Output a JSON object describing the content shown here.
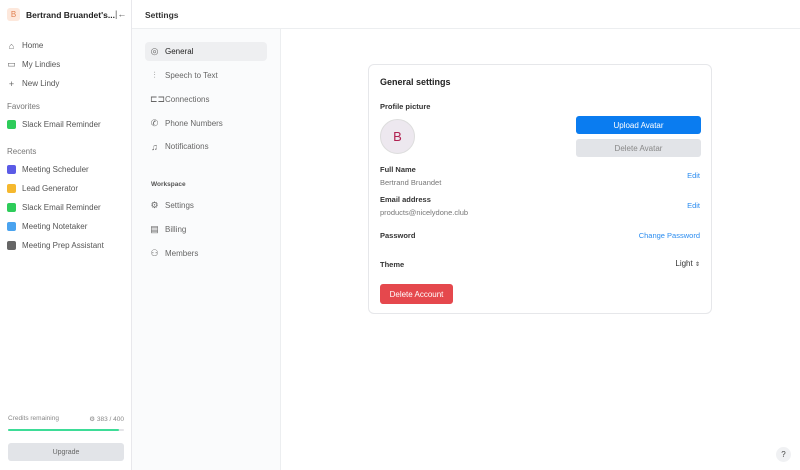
{
  "workspace": {
    "initial": "B",
    "name": "Bertrand Bruandet's..."
  },
  "sidebar": {
    "nav": [
      {
        "label": "Home",
        "icon": "home-icon"
      },
      {
        "label": "My Lindies",
        "icon": "folder-icon"
      },
      {
        "label": "New Lindy",
        "icon": "plus-icon"
      }
    ],
    "favorites_label": "Favorites",
    "favorites": [
      {
        "label": "Slack Email Reminder",
        "color": "#2ecc5a"
      }
    ],
    "recents_label": "Recents",
    "recents": [
      {
        "label": "Meeting Scheduler",
        "color": "#5b5be6"
      },
      {
        "label": "Lead Generator",
        "color": "#f5b82e"
      },
      {
        "label": "Slack Email Reminder",
        "color": "#2ecc5a"
      },
      {
        "label": "Meeting Notetaker",
        "color": "#4aa3ef"
      },
      {
        "label": "Meeting Prep Assistant",
        "color": "#666666"
      }
    ],
    "credits_label": "Credits remaining",
    "credits_value": "383 / 400",
    "credits_fraction": 0.9575,
    "upgrade": "Upgrade"
  },
  "header": {
    "title": "Settings"
  },
  "settings_nav": {
    "items": [
      {
        "label": "General",
        "icon": "user-circle-icon",
        "active": true
      },
      {
        "label": "Speech to Text",
        "icon": "waveform-icon"
      },
      {
        "label": "Connections",
        "icon": "link-icon"
      },
      {
        "label": "Phone Numbers",
        "icon": "phone-icon"
      },
      {
        "label": "Notifications",
        "icon": "bell-icon"
      }
    ],
    "workspace_label": "Workspace",
    "workspace_items": [
      {
        "label": "Settings",
        "icon": "gear-icon"
      },
      {
        "label": "Billing",
        "icon": "receipt-icon"
      },
      {
        "label": "Members",
        "icon": "users-icon"
      }
    ]
  },
  "general": {
    "title": "General settings",
    "profile_picture": "Profile picture",
    "avatar_initial": "B",
    "upload": "Upload Avatar",
    "delete_avatar": "Delete Avatar",
    "full_name_label": "Full Name",
    "full_name": "Bertrand Bruandet",
    "edit": "Edit",
    "email_label": "Email address",
    "email": "products@nicelydone.club",
    "password_label": "Password",
    "change_password": "Change Password",
    "theme_label": "Theme",
    "theme_value": "Light",
    "delete_account": "Delete Account"
  },
  "help": "?"
}
